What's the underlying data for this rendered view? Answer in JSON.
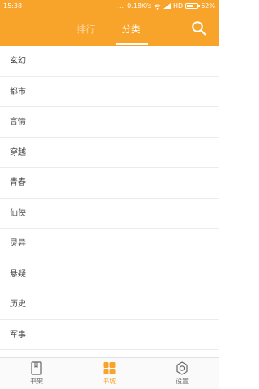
{
  "statusbar": {
    "time": "15:38",
    "dots": "...",
    "speed": "0.18K/s",
    "network": "HD",
    "battery": "62%",
    "battery_level": 0.62
  },
  "header": {
    "tabs": [
      {
        "label": "排行",
        "active": false
      },
      {
        "label": "分类",
        "active": true
      }
    ],
    "search_icon": "search-icon"
  },
  "categories": [
    "玄幻",
    "都市",
    "言情",
    "穿越",
    "青春",
    "仙侠",
    "灵异",
    "悬疑",
    "历史",
    "军事"
  ],
  "bottom_nav": [
    {
      "label": "书架",
      "icon": "bookshelf-icon",
      "active": false
    },
    {
      "label": "书城",
      "icon": "bookstore-icon",
      "active": true
    },
    {
      "label": "设置",
      "icon": "settings-icon",
      "active": false
    }
  ],
  "colors": {
    "accent": "#f8a32a",
    "text": "#444444",
    "divider": "#ececec",
    "nav_inactive": "#666666"
  }
}
